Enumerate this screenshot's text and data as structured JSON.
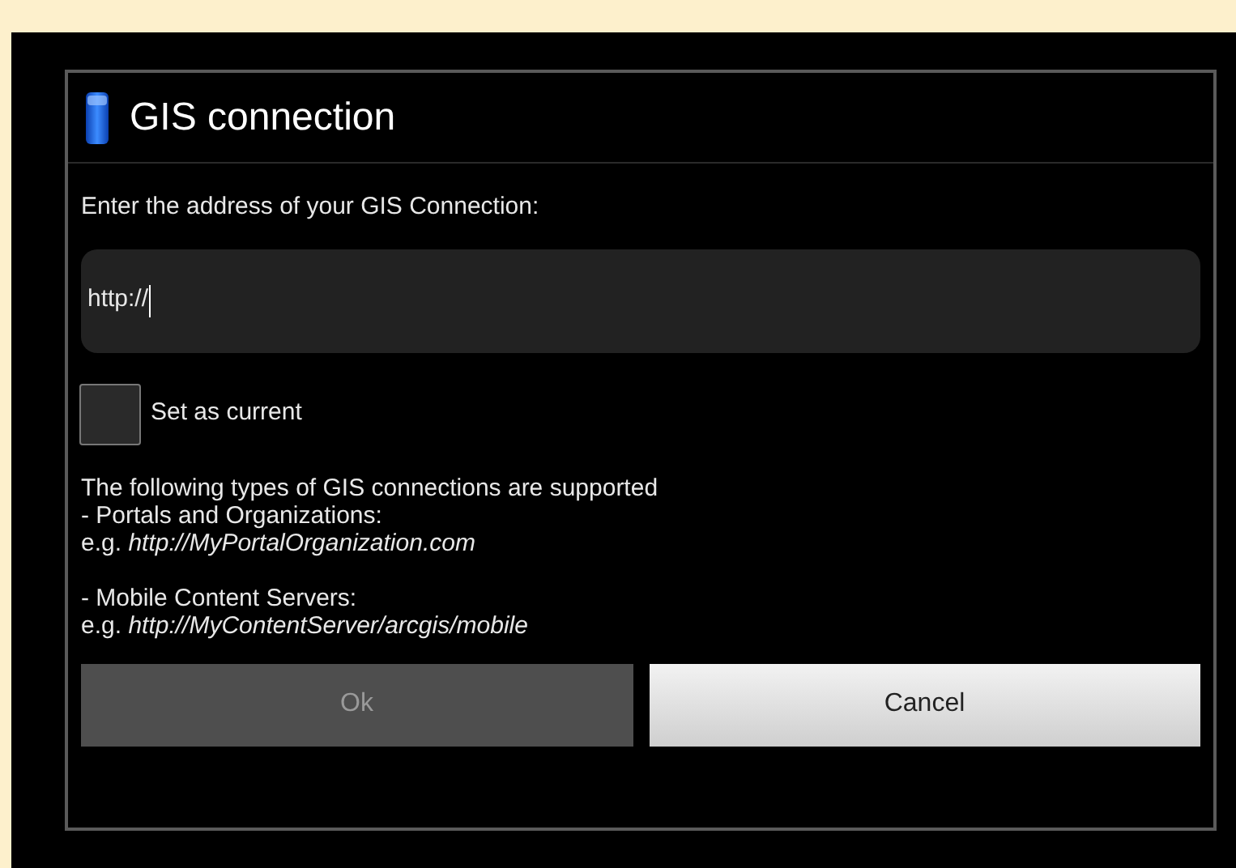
{
  "dialog": {
    "title": "GIS connection",
    "prompt": "Enter the address of your GIS Connection:",
    "address_field": {
      "value": "http://",
      "focused": true
    },
    "set_as_current": {
      "label": "Set as current",
      "checked": false
    },
    "info": {
      "intro": "The following types of GIS connections are supported",
      "sections": [
        {
          "heading": "- Portals and Organizations:",
          "example": "e.g. *http://MyPortalOrganization.com*"
        },
        {
          "heading": "- Mobile Content Servers:",
          "example": "e.g. *http://MyContentServer/arcgis/mobile*"
        }
      ]
    },
    "buttons": [
      {
        "label": "Ok",
        "disabled": true
      },
      {
        "label": "Cancel",
        "disabled": false
      }
    ]
  }
}
